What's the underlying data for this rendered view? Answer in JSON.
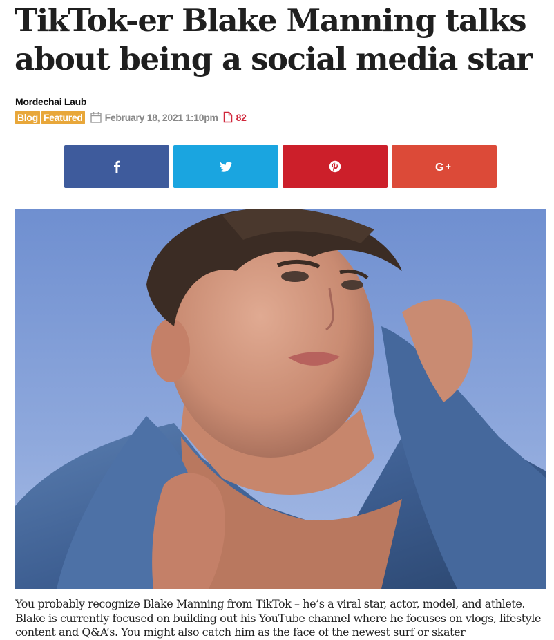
{
  "article": {
    "title": "TikTok-er Blake Manning talks about being a social media star",
    "author": "Mordechai Laub",
    "categories": [
      "Blog",
      "Featured"
    ],
    "date": "February 18, 2021 1:10pm",
    "comment_count": "82",
    "body": "You probably recognize Blake Manning from TikTok – he’s a viral star, actor, model, and athlete. Blake is currently focused on building out his YouTube channel where he focuses on vlogs, lifestyle content and Q&A’s. You might also catch him as the face of the newest surf or skater"
  },
  "share": {
    "facebook_icon": "facebook-icon",
    "twitter_icon": "twitter-icon",
    "pinterest_icon": "pinterest-icon",
    "googleplus_icon": "googleplus-icon",
    "colors": {
      "facebook": "#3e5b9c",
      "twitter": "#1aa5e0",
      "pinterest": "#cc1f2a",
      "googleplus": "#dc4a38"
    }
  },
  "meta_icons": {
    "date": "calendar-icon",
    "comments": "document-icon"
  },
  "colors": {
    "badge": "#e8a73a",
    "date_text": "#888888",
    "count_text": "#d0263a"
  }
}
